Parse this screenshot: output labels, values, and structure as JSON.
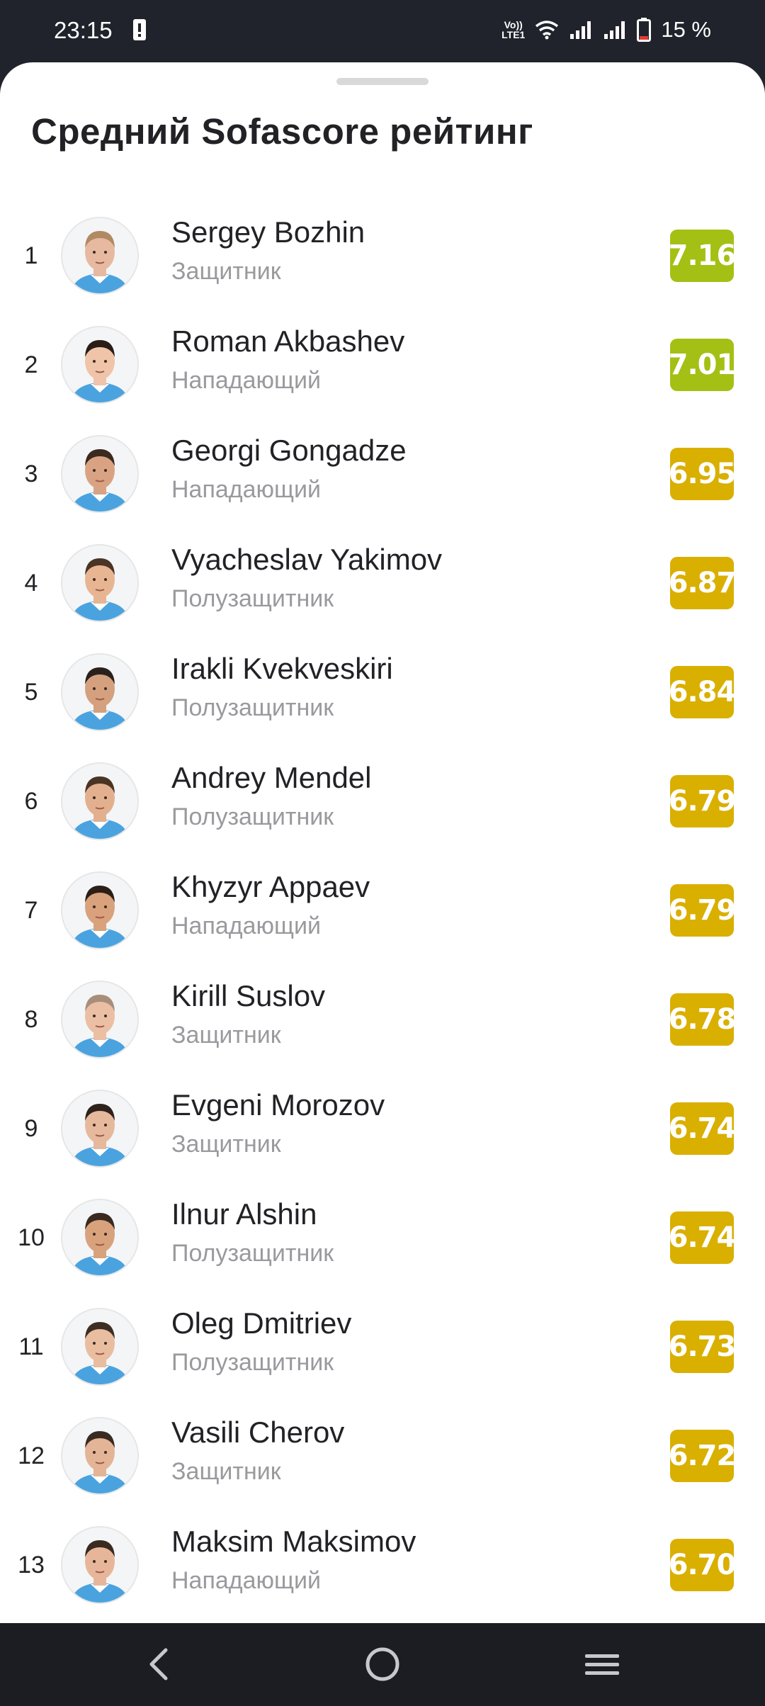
{
  "status": {
    "time": "23:15",
    "volte": "Vo)) LTE1",
    "battery": "15 %"
  },
  "sheet": {
    "title": "Средний Sofascore рейтинг"
  },
  "colors": {
    "rating_high": "#a4c014",
    "rating_mid": "#d9af00"
  },
  "players": [
    {
      "rank": "1",
      "name": "Sergey Bozhin",
      "position": "Защитник",
      "rating": "7.16",
      "tier": "high"
    },
    {
      "rank": "2",
      "name": "Roman Akbashev",
      "position": "Нападающий",
      "rating": "7.01",
      "tier": "high"
    },
    {
      "rank": "3",
      "name": "Georgi Gongadze",
      "position": "Нападающий",
      "rating": "6.95",
      "tier": "mid"
    },
    {
      "rank": "4",
      "name": "Vyacheslav Yakimov",
      "position": "Полузащитник",
      "rating": "6.87",
      "tier": "mid"
    },
    {
      "rank": "5",
      "name": "Irakli Kvekveskiri",
      "position": "Полузащитник",
      "rating": "6.84",
      "tier": "mid"
    },
    {
      "rank": "6",
      "name": "Andrey Mendel",
      "position": "Полузащитник",
      "rating": "6.79",
      "tier": "mid"
    },
    {
      "rank": "7",
      "name": "Khyzyr Appaev",
      "position": "Нападающий",
      "rating": "6.79",
      "tier": "mid"
    },
    {
      "rank": "8",
      "name": "Kirill Suslov",
      "position": "Защитник",
      "rating": "6.78",
      "tier": "mid"
    },
    {
      "rank": "9",
      "name": "Evgeni Morozov",
      "position": "Защитник",
      "rating": "6.74",
      "tier": "mid"
    },
    {
      "rank": "10",
      "name": "Ilnur Alshin",
      "position": "Полузащитник",
      "rating": "6.74",
      "tier": "mid"
    },
    {
      "rank": "11",
      "name": "Oleg Dmitriev",
      "position": "Полузащитник",
      "rating": "6.73",
      "tier": "mid"
    },
    {
      "rank": "12",
      "name": "Vasili Cherov",
      "position": "Защитник",
      "rating": "6.72",
      "tier": "mid"
    },
    {
      "rank": "13",
      "name": "Maksim Maksimov",
      "position": "Нападающий",
      "rating": "6.70",
      "tier": "mid"
    }
  ],
  "nav": {
    "back_icon": "back-icon",
    "home_icon": "home-icon",
    "menu_icon": "menu-icon"
  }
}
